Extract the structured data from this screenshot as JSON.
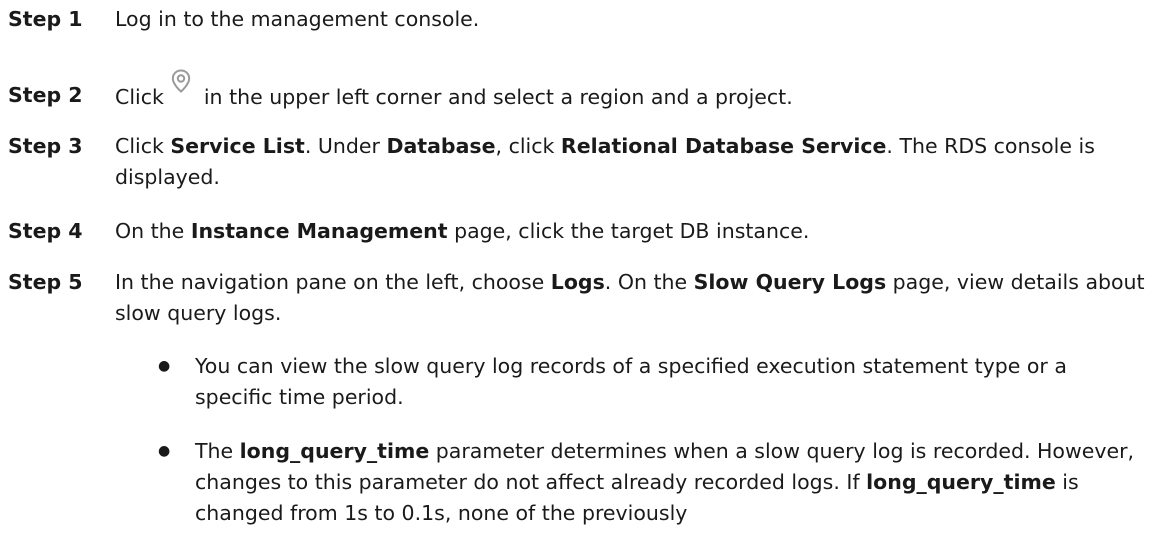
{
  "steps": [
    {
      "label": "Step 1",
      "text": "Log in to the management console."
    },
    {
      "label": "Step 2",
      "pre": "Click",
      "icon": "location-pin-icon",
      "post": "in the upper left corner and select a region and a project."
    },
    {
      "label": "Step 3",
      "parts": [
        "Click ",
        "Service List",
        ". Under ",
        "Database",
        ", click ",
        "Relational Database Service",
        ". The RDS console is displayed."
      ]
    },
    {
      "label": "Step 4",
      "parts": [
        "On the ",
        "Instance Management",
        " page, click the target DB instance."
      ]
    },
    {
      "label": "Step 5",
      "parts": [
        "In the navigation pane on the left, choose ",
        "Logs",
        ". On the ",
        "Slow Query Logs",
        " page, view details about slow query logs."
      ]
    }
  ],
  "bullets": [
    {
      "text": "You can view the slow query log records of a specified execution statement type or a specific time period."
    },
    {
      "parts": [
        "The ",
        "long_query_time",
        " parameter determines when a slow query log is recorded. However, changes to this parameter do not affect already recorded logs. If ",
        "long_query_time",
        " is changed from 1s to 0.1s, none of the previously"
      ]
    }
  ],
  "bullet_symbol": "●",
  "colors": {
    "text": "#1a1a1a",
    "icon": "#9a9a9a"
  }
}
